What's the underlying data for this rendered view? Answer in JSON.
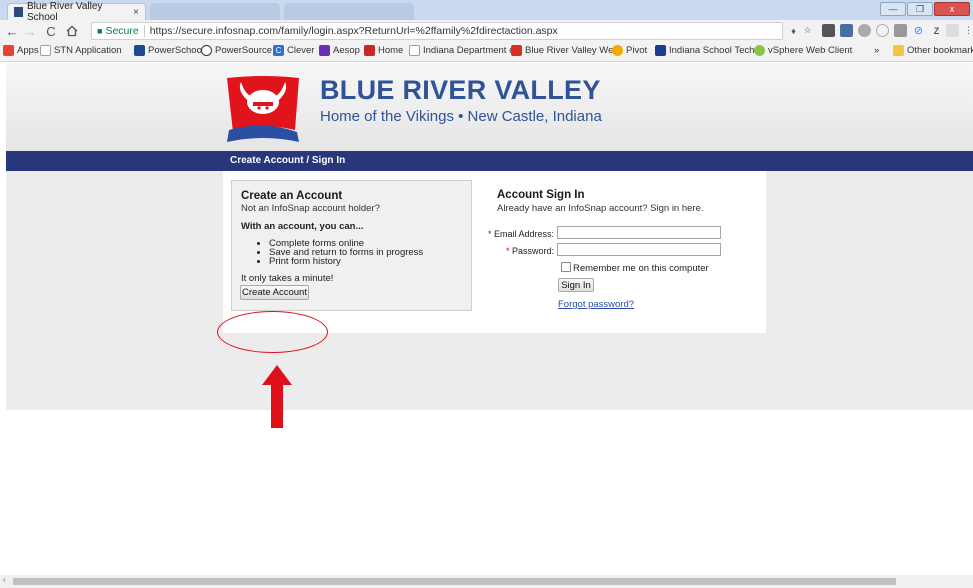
{
  "browser": {
    "tabs": [
      {
        "label": "Blue River Valley School",
        "close": "×",
        "active": true
      },
      {
        "label": "",
        "active": false
      },
      {
        "label": "",
        "active": false
      }
    ],
    "window_controls": {
      "min": "—",
      "restore": "❐",
      "close": "x"
    },
    "omnibox": {
      "secure_label": "Secure",
      "url": "https://secure.infosnap.com/family/login.aspx?ReturnUrl=%2ffamily%2fdirectaction.aspx"
    },
    "bookmarks": [
      {
        "label": "Apps",
        "icon": "apps-grid-icon",
        "color": "#e94235"
      },
      {
        "label": "STN Application",
        "icon": "page-icon",
        "color": "#9aa0a6"
      },
      {
        "label": "PowerSchool",
        "icon": "powerschool-icon",
        "color": "#1c4a8c"
      },
      {
        "label": "PowerSource",
        "icon": "power-icon",
        "color": "#333333"
      },
      {
        "label": "Clever",
        "icon": "clever-icon",
        "color": "#2f6fd8"
      },
      {
        "label": "Aesop",
        "icon": "aesop-icon",
        "color": "#6b2fb3"
      },
      {
        "label": "Home",
        "icon": "home-icon",
        "color": "#c62828"
      },
      {
        "label": "Indiana Department o",
        "icon": "page-icon",
        "color": "#9aa0a6"
      },
      {
        "label": "Blue River Valley Web",
        "icon": "brv-icon",
        "color": "#d93025"
      },
      {
        "label": "Pivot",
        "icon": "pivot-icon",
        "color": "#f2a900"
      },
      {
        "label": "Indiana School Tech F",
        "icon": "indiana-tech-icon",
        "color": "#1a3d8f"
      },
      {
        "label": "vSphere Web Client",
        "icon": "vsphere-icon",
        "color": "#8bc34a"
      }
    ],
    "other_bookmarks": "Other bookmarks",
    "overflow": "»"
  },
  "site": {
    "name": "BLUE RIVER VALLEY",
    "tagline": "Home of the Vikings • New Castle, Indiana",
    "nav_title": "Create Account / Sign In",
    "brand_color": "#2f5496",
    "nav_color": "#28367c"
  },
  "create_account": {
    "title": "Create an Account",
    "subtitle": "Not an InfoSnap account holder?",
    "lead": "With an account, you can...",
    "features": [
      "Complete forms online",
      "Save and return to forms in progress",
      "Print form history"
    ],
    "note": "It only takes a minute!",
    "button": "Create Account"
  },
  "sign_in": {
    "title": "Account Sign In",
    "subtitle": "Already have an InfoSnap account? Sign in here.",
    "required_mark": "*",
    "email_label": "Email Address:",
    "email_value": "",
    "password_label": "Password:",
    "password_value": "",
    "remember_label": "Remember me on this computer",
    "remember_checked": false,
    "button": "Sign In",
    "forgot_link": "Forgot password?"
  },
  "annotation": {
    "color": "#e0101a"
  }
}
